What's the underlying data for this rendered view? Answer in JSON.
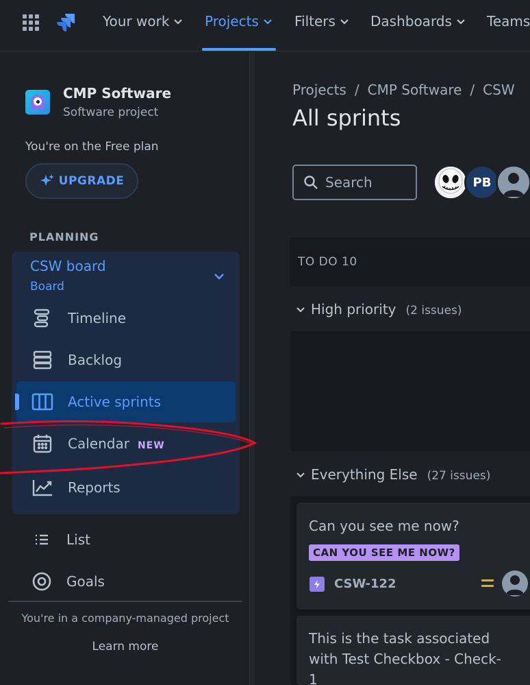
{
  "topnav": {
    "items": [
      {
        "label": "Your work"
      },
      {
        "label": "Projects"
      },
      {
        "label": "Filters"
      },
      {
        "label": "Dashboards"
      },
      {
        "label": "Teams"
      }
    ]
  },
  "sidebar": {
    "project_name": "CMP Software",
    "project_type": "Software project",
    "plan_note": "You're on the Free plan",
    "upgrade_label": "UPGRADE",
    "section_label": "PLANNING",
    "board_title": "CSW board",
    "board_subtitle": "Board",
    "board_items": [
      {
        "label": "Timeline"
      },
      {
        "label": "Backlog"
      },
      {
        "label": "Active sprints"
      },
      {
        "label": "Calendar",
        "badge": "NEW"
      },
      {
        "label": "Reports"
      }
    ],
    "other_items": [
      {
        "label": "List"
      },
      {
        "label": "Goals"
      }
    ],
    "company_note": "You're in a company-managed project",
    "learn_more": "Learn more"
  },
  "main": {
    "breadcrumbs": [
      "Projects",
      "CMP Software",
      "CSW"
    ],
    "title": "All sprints",
    "search_placeholder": "Search",
    "avatar_pb": "PB",
    "column_header": "TO DO 10",
    "swimlanes": [
      {
        "title": "High priority",
        "count": "(2 issues)"
      },
      {
        "title": "Everything Else",
        "count": "(27 issues)"
      }
    ],
    "cards": [
      {
        "title": "Can you see me now?",
        "epic": "CAN YOU SEE ME NOW?",
        "key": "CSW-122"
      },
      {
        "title": "This is the task associated with Test Checkbox - Check-1"
      }
    ]
  },
  "colors": {
    "accent": "#579dff",
    "background": "#1d2125",
    "active_item_bg": "#0c3a6e",
    "epic_badge": "#b691f5",
    "annotation_red": "#e0102a"
  }
}
